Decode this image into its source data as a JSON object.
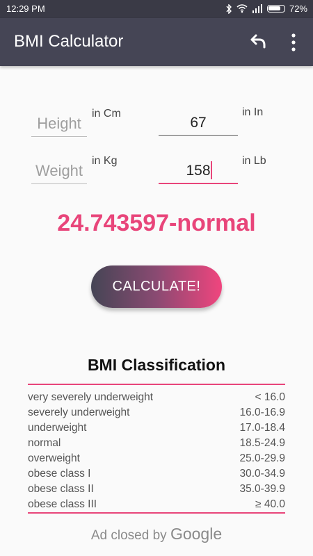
{
  "status": {
    "time": "12:29 PM",
    "battery": "72%"
  },
  "appbar": {
    "title": "BMI Calculator"
  },
  "form": {
    "height_label": "Height",
    "height_unit": "in Cm",
    "height_value": "67",
    "height_alt_unit": "in In",
    "weight_label": "Weight",
    "weight_unit": "in Kg",
    "weight_value": "158",
    "weight_alt_unit": "in Lb"
  },
  "result": "24.743597-normal",
  "calculate_label": "CALCULATE!",
  "classification": {
    "title": "BMI Classification",
    "rows": [
      {
        "category": "very severely underweight",
        "range": "< 16.0"
      },
      {
        "category": "severely underweight",
        "range": "16.0-16.9"
      },
      {
        "category": "underweight",
        "range": "17.0-18.4"
      },
      {
        "category": "normal",
        "range": "18.5-24.9"
      },
      {
        "category": "overweight",
        "range": "25.0-29.9"
      },
      {
        "category": "obese class I",
        "range": "30.0-34.9"
      },
      {
        "category": "obese class II",
        "range": "35.0-39.9"
      },
      {
        "category": "obese class III",
        "range": "≥ 40.0"
      }
    ]
  },
  "ad": {
    "text": "Ad closed by ",
    "brand": "Google"
  },
  "colors": {
    "accent": "#e8457a",
    "appbar": "#454555"
  },
  "icons": [
    "bluetooth-icon",
    "wifi-icon",
    "signal-icon",
    "battery-icon",
    "undo-icon",
    "more-vert-icon"
  ]
}
